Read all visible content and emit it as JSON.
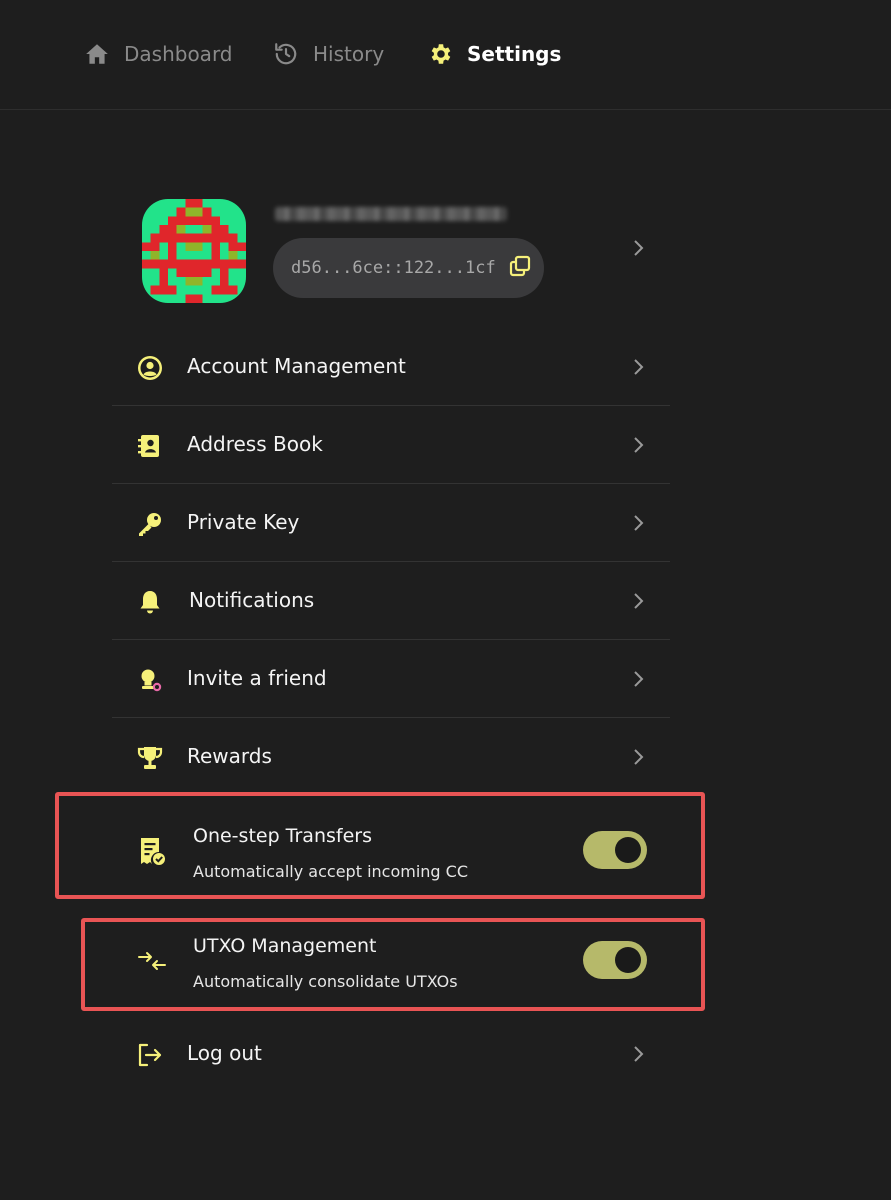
{
  "nav": {
    "items": [
      {
        "label": "Dashboard",
        "icon": "home-icon"
      },
      {
        "label": "History",
        "icon": "history-icon"
      },
      {
        "label": "Settings",
        "icon": "gear-icon",
        "active": true
      }
    ]
  },
  "profile": {
    "address": "d56...6ce::122...1cf",
    "avatar_colors": [
      "#22e38a",
      "#e0262b",
      "#8fb52a"
    ]
  },
  "menu": {
    "items": [
      {
        "label": "Account Management",
        "icon": "user-circle-icon"
      },
      {
        "label": "Address Book",
        "icon": "contact-book-icon"
      },
      {
        "label": "Private Key",
        "icon": "key-icon"
      },
      {
        "label": "Notifications",
        "icon": "bell-icon"
      },
      {
        "label": "Invite a friend",
        "icon": "invite-friend-icon"
      },
      {
        "label": "Rewards",
        "icon": "trophy-icon"
      }
    ],
    "logout": {
      "label": "Log out",
      "icon": "logout-icon"
    }
  },
  "toggles": [
    {
      "title": "One-step Transfers",
      "subtitle": "Automatically accept incoming CC",
      "icon": "receipt-check-icon",
      "on": true
    },
    {
      "title": "UTXO Management",
      "subtitle": "Automatically consolidate UTXOs",
      "icon": "consolidate-arrows-icon",
      "on": true
    }
  ],
  "colors": {
    "accent": "#f5f07a",
    "toggle_on": "#b6b96a",
    "highlight": "#e85454",
    "background": "#1e1e1e"
  }
}
